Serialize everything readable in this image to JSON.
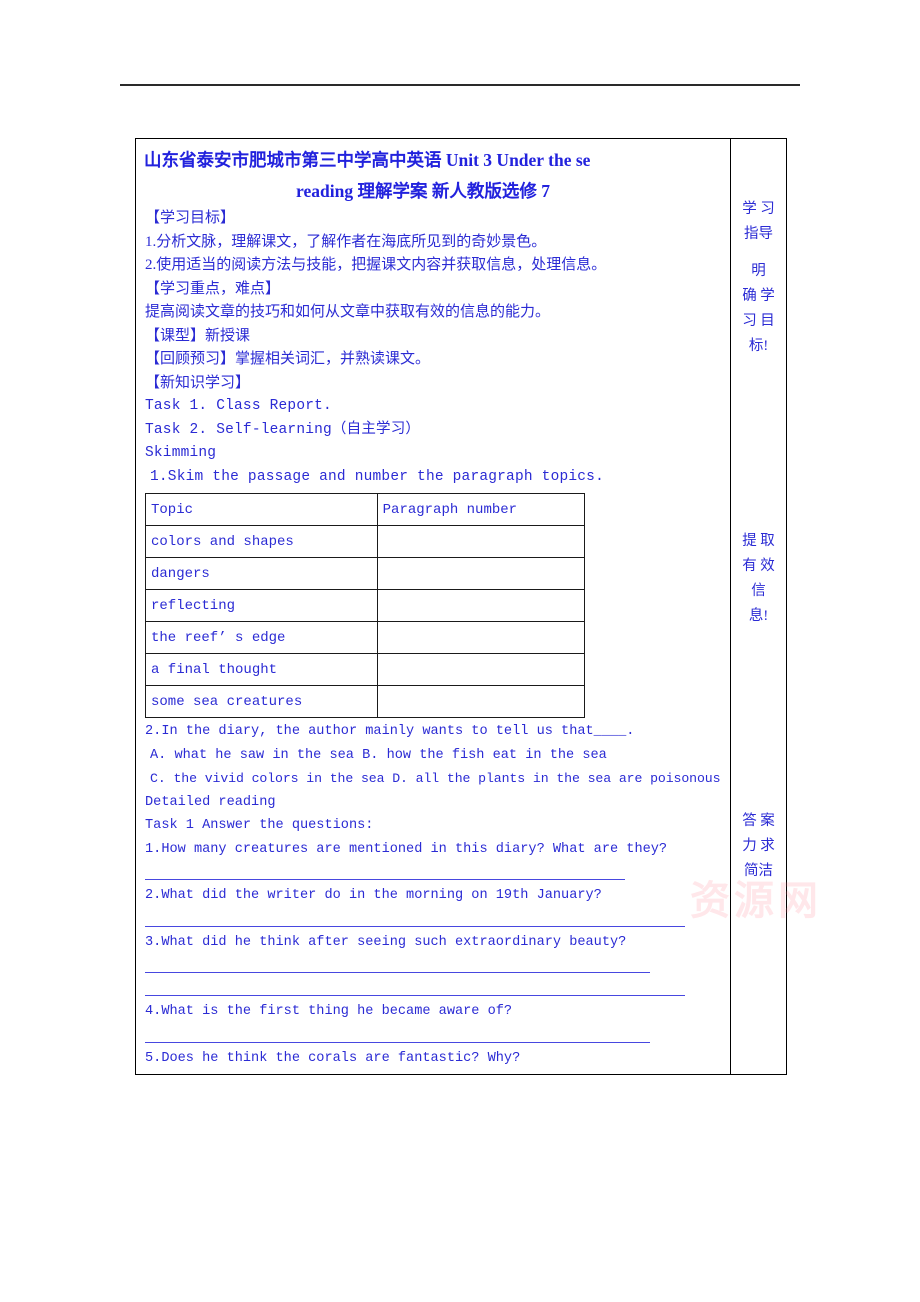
{
  "document": {
    "title_line_1": "山东省泰安市肥城市第三中学高中英语 Unit 3 Under the se",
    "title_line_2": "reading 理解学案 新人教版选修 7",
    "watermark_text": "资源网"
  },
  "colors": {
    "text_blue": "#2b2bd4",
    "title_blue": "#2222dd",
    "rule_blue": "#4747e0",
    "border_black": "#000000",
    "watermark_pink": "#ff788c"
  },
  "body_lines": {
    "objectives_heading": "【学习目标】",
    "objective_1": "1.分析文脉，理解课文，了解作者在海底所见到的奇妙景色。",
    "objective_2": "2.使用适当的阅读方法与技能，把握课文内容并获取信息，处理信息。",
    "focus_heading": "【学习重点，难点】",
    "focus_text": "提高阅读文章的技巧和如何从文章中获取有效的信息的能力。",
    "lesson_type_heading": "【课型】",
    "lesson_type_value": "新授课",
    "review_heading": "【回顾预习】",
    "review_value": "掌握相关词汇，并熟读课文。",
    "new_knowledge_heading": "【新知识学习】",
    "task_1": "Task 1. Class Report.",
    "task_2": "Task 2. Self-learning（自主学习）",
    "skimming_label": "Skimming",
    "skim_instruction": "1.Skim the passage and number the  paragraph topics.",
    "question_2_stem": "2.In the diary, the author mainly wants to tell us that____.",
    "question_2_options_line_1": "A. what he saw in the sea   B. how the fish eat in the sea",
    "question_2_options_line_2": "C. the vivid colors in the sea  D. all the plants in the sea are poisonous",
    "detailed_reading_label": "Detailed reading",
    "detailed_task_1": "Task 1   Answer the questions:",
    "dq_1": "1.How many creatures are mentioned in this diary? What are they?",
    "dq_2": "2.What did the writer do in the morning on 19th January?",
    "dq_3": "3.What did he think after seeing such extraordinary beauty?",
    "dq_4": "4.What is the first thing he became aware of?",
    "dq_5": "5.Does he think the corals are fantastic? Why?"
  },
  "skim_table": {
    "headers": [
      "Topic",
      "Paragraph number"
    ],
    "rows": [
      [
        "colors and shapes",
        ""
      ],
      [
        "dangers",
        ""
      ],
      [
        "reflecting",
        ""
      ],
      [
        "the reef’ s edge",
        ""
      ],
      [
        "a final thought",
        ""
      ],
      [
        "some sea creatures",
        ""
      ]
    ]
  },
  "sidebar": {
    "block_1": [
      "学 习",
      "指导"
    ],
    "block_2": [
      "明",
      "确 学",
      "习 目",
      "标!"
    ],
    "block_3": [
      "提 取",
      "有 效",
      "信",
      "息!"
    ],
    "block_4": [
      "答 案",
      "力 求",
      "简洁"
    ]
  }
}
